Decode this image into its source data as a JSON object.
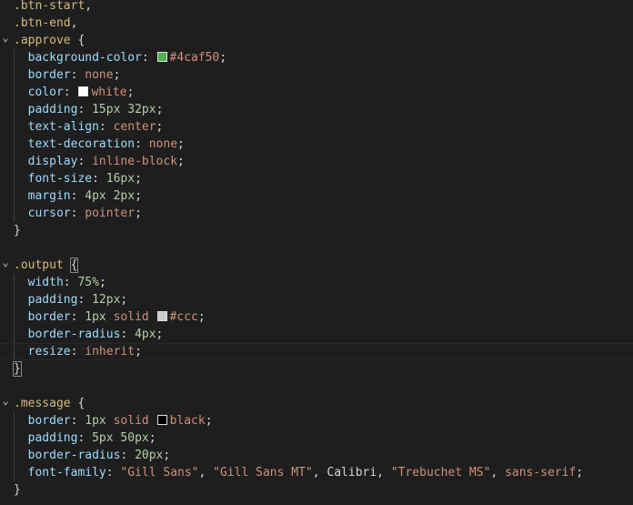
{
  "editor": {
    "lines": [
      {
        "fold": "",
        "indent": false,
        "tokens": [
          {
            "c": "sel",
            "t": ".btn-start"
          },
          {
            "c": "punc",
            "t": ","
          }
        ]
      },
      {
        "fold": "",
        "indent": false,
        "tokens": [
          {
            "c": "sel",
            "t": ".btn-end"
          },
          {
            "c": "punc",
            "t": ","
          }
        ]
      },
      {
        "fold": "v",
        "indent": false,
        "tokens": [
          {
            "c": "sel",
            "t": ".approve"
          },
          {
            "c": "punc",
            "t": " {"
          }
        ]
      },
      {
        "fold": "",
        "indent": true,
        "tokens": [
          {
            "c": "prop",
            "t": "  background-color"
          },
          {
            "c": "punc",
            "t": ": "
          },
          {
            "c": "swatch",
            "color": "#4caf50"
          },
          {
            "c": "val",
            "t": "#4caf50"
          },
          {
            "c": "punc",
            "t": ";"
          }
        ]
      },
      {
        "fold": "",
        "indent": true,
        "tokens": [
          {
            "c": "prop",
            "t": "  border"
          },
          {
            "c": "punc",
            "t": ": "
          },
          {
            "c": "val",
            "t": "none"
          },
          {
            "c": "punc",
            "t": ";"
          }
        ]
      },
      {
        "fold": "",
        "indent": true,
        "tokens": [
          {
            "c": "prop",
            "t": "  color"
          },
          {
            "c": "punc",
            "t": ": "
          },
          {
            "c": "swatch",
            "color": "#ffffff"
          },
          {
            "c": "val",
            "t": "white"
          },
          {
            "c": "punc",
            "t": ";"
          }
        ]
      },
      {
        "fold": "",
        "indent": true,
        "tokens": [
          {
            "c": "prop",
            "t": "  padding"
          },
          {
            "c": "punc",
            "t": ": "
          },
          {
            "c": "num",
            "t": "15px 32px"
          },
          {
            "c": "punc",
            "t": ";"
          }
        ]
      },
      {
        "fold": "",
        "indent": true,
        "tokens": [
          {
            "c": "prop",
            "t": "  text-align"
          },
          {
            "c": "punc",
            "t": ": "
          },
          {
            "c": "val",
            "t": "center"
          },
          {
            "c": "punc",
            "t": ";"
          }
        ]
      },
      {
        "fold": "",
        "indent": true,
        "tokens": [
          {
            "c": "prop",
            "t": "  text-decoration"
          },
          {
            "c": "punc",
            "t": ": "
          },
          {
            "c": "val",
            "t": "none"
          },
          {
            "c": "punc",
            "t": ";"
          }
        ]
      },
      {
        "fold": "",
        "indent": true,
        "tokens": [
          {
            "c": "prop",
            "t": "  display"
          },
          {
            "c": "punc",
            "t": ": "
          },
          {
            "c": "val",
            "t": "inline-block"
          },
          {
            "c": "punc",
            "t": ";"
          }
        ]
      },
      {
        "fold": "",
        "indent": true,
        "tokens": [
          {
            "c": "prop",
            "t": "  font-size"
          },
          {
            "c": "punc",
            "t": ": "
          },
          {
            "c": "num",
            "t": "16px"
          },
          {
            "c": "punc",
            "t": ";"
          }
        ]
      },
      {
        "fold": "",
        "indent": true,
        "tokens": [
          {
            "c": "prop",
            "t": "  margin"
          },
          {
            "c": "punc",
            "t": ": "
          },
          {
            "c": "num",
            "t": "4px 2px"
          },
          {
            "c": "punc",
            "t": ";"
          }
        ]
      },
      {
        "fold": "",
        "indent": true,
        "tokens": [
          {
            "c": "prop",
            "t": "  cursor"
          },
          {
            "c": "punc",
            "t": ": "
          },
          {
            "c": "val",
            "t": "pointer"
          },
          {
            "c": "punc",
            "t": ";"
          }
        ]
      },
      {
        "fold": "",
        "indent": false,
        "tokens": [
          {
            "c": "punc",
            "t": "}"
          }
        ]
      },
      {
        "fold": "",
        "indent": false,
        "tokens": []
      },
      {
        "fold": "v",
        "indent": false,
        "tokens": [
          {
            "c": "sel",
            "t": ".output"
          },
          {
            "c": "punc",
            "t": " "
          },
          {
            "c": "brace",
            "t": "{"
          }
        ]
      },
      {
        "fold": "",
        "indent": true,
        "tokens": [
          {
            "c": "prop",
            "t": "  width"
          },
          {
            "c": "punc",
            "t": ": "
          },
          {
            "c": "num",
            "t": "75%"
          },
          {
            "c": "punc",
            "t": ";"
          }
        ]
      },
      {
        "fold": "",
        "indent": true,
        "tokens": [
          {
            "c": "prop",
            "t": "  padding"
          },
          {
            "c": "punc",
            "t": ": "
          },
          {
            "c": "num",
            "t": "12px"
          },
          {
            "c": "punc",
            "t": ";"
          }
        ]
      },
      {
        "fold": "",
        "indent": true,
        "tokens": [
          {
            "c": "prop",
            "t": "  border"
          },
          {
            "c": "punc",
            "t": ": "
          },
          {
            "c": "num",
            "t": "1px"
          },
          {
            "c": "val",
            "t": " solid "
          },
          {
            "c": "swatch",
            "color": "#cccccc"
          },
          {
            "c": "val",
            "t": "#ccc"
          },
          {
            "c": "punc",
            "t": ";"
          }
        ]
      },
      {
        "fold": "",
        "indent": true,
        "tokens": [
          {
            "c": "prop",
            "t": "  border-radius"
          },
          {
            "c": "punc",
            "t": ": "
          },
          {
            "c": "num",
            "t": "4px"
          },
          {
            "c": "punc",
            "t": ";"
          }
        ]
      },
      {
        "fold": "",
        "indent": true,
        "current": true,
        "tokens": [
          {
            "c": "prop",
            "t": "  resize"
          },
          {
            "c": "punc",
            "t": ": "
          },
          {
            "c": "val",
            "t": "inherit"
          },
          {
            "c": "punc",
            "t": ";"
          }
        ]
      },
      {
        "fold": "",
        "indent": false,
        "tokens": [
          {
            "c": "brace",
            "t": "}"
          }
        ]
      },
      {
        "fold": "",
        "indent": false,
        "tokens": []
      },
      {
        "fold": "v",
        "indent": false,
        "tokens": [
          {
            "c": "sel",
            "t": ".message"
          },
          {
            "c": "punc",
            "t": " {"
          }
        ]
      },
      {
        "fold": "",
        "indent": true,
        "tokens": [
          {
            "c": "prop",
            "t": "  border"
          },
          {
            "c": "punc",
            "t": ": "
          },
          {
            "c": "num",
            "t": "1px"
          },
          {
            "c": "val",
            "t": " solid "
          },
          {
            "c": "swatch",
            "color": "#000000"
          },
          {
            "c": "val",
            "t": "black"
          },
          {
            "c": "punc",
            "t": ";"
          }
        ]
      },
      {
        "fold": "",
        "indent": true,
        "tokens": [
          {
            "c": "prop",
            "t": "  padding"
          },
          {
            "c": "punc",
            "t": ": "
          },
          {
            "c": "num",
            "t": "5px 50px"
          },
          {
            "c": "punc",
            "t": ";"
          }
        ]
      },
      {
        "fold": "",
        "indent": true,
        "tokens": [
          {
            "c": "prop",
            "t": "  border-radius"
          },
          {
            "c": "punc",
            "t": ": "
          },
          {
            "c": "num",
            "t": "20px"
          },
          {
            "c": "punc",
            "t": ";"
          }
        ]
      },
      {
        "fold": "",
        "indent": true,
        "tokens": [
          {
            "c": "prop",
            "t": "  font-family"
          },
          {
            "c": "punc",
            "t": ": "
          },
          {
            "c": "val",
            "t": "\"Gill Sans\""
          },
          {
            "c": "punc",
            "t": ", "
          },
          {
            "c": "val",
            "t": "\"Gill Sans MT\""
          },
          {
            "c": "punc",
            "t": ", Calibri, "
          },
          {
            "c": "val",
            "t": "\"Trebuchet MS\""
          },
          {
            "c": "punc",
            "t": ", "
          },
          {
            "c": "val",
            "t": "sans-serif"
          },
          {
            "c": "punc",
            "t": ";"
          }
        ]
      },
      {
        "fold": "",
        "indent": false,
        "tokens": [
          {
            "c": "punc",
            "t": "}"
          }
        ]
      }
    ]
  }
}
